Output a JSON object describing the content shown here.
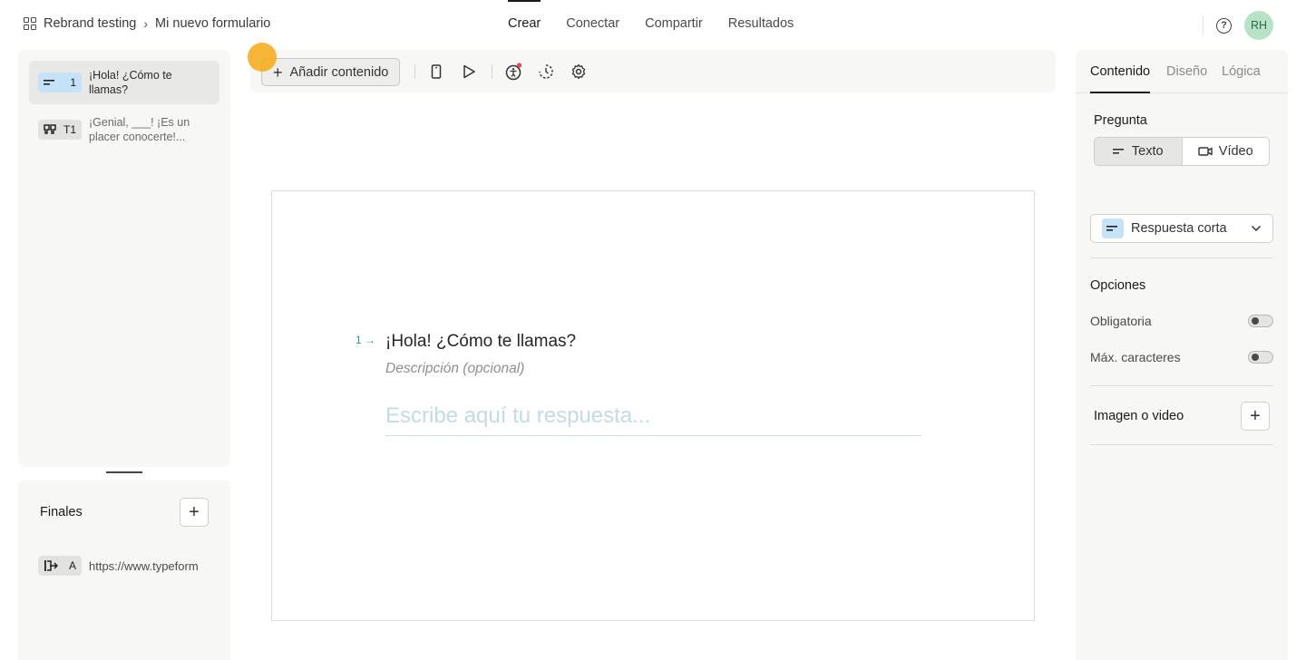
{
  "breadcrumb": {
    "workspace": "Rebrand testing",
    "separator": "›",
    "form": "Mi nuevo formulario"
  },
  "nav": {
    "tabs": [
      "Crear",
      "Conectar",
      "Compartir",
      "Resultados"
    ],
    "active": "Crear"
  },
  "user": {
    "initials": "RH"
  },
  "help": {
    "glyph": "?"
  },
  "questions": [
    {
      "badge_num": "1",
      "text": "¡Hola! ¿Cómo te llamas?",
      "icon": "short-text-icon",
      "active": true
    },
    {
      "badge_num": "T1",
      "text": "¡Genial, ___! ¡Es un placer conocerte!...",
      "icon": "quote-icon",
      "active": false
    }
  ],
  "endings": {
    "title": "Finales",
    "items": [
      {
        "badge": "A",
        "text": "https://www.typeform",
        "icon": "redirect-icon"
      }
    ]
  },
  "toolbar": {
    "add_label": "Añadir contenido",
    "icons": [
      "mobile-preview-icon",
      "play-icon",
      "accessibility-icon",
      "loading-icon",
      "settings-icon"
    ]
  },
  "canvas": {
    "question_number": "1",
    "question_title": "¡Hola! ¿Cómo te llamas?",
    "description": "Descripción (opcional)",
    "answer_placeholder": "Escribe aquí tu respuesta..."
  },
  "right_panel": {
    "tabs": [
      "Contenido",
      "Diseño",
      "Lógica"
    ],
    "active_tab": "Contenido",
    "pregunta_label": "Pregunta",
    "seg": {
      "text": "Texto",
      "video": "Vídeo",
      "active": "Texto"
    },
    "type_dropdown": "Respuesta corta",
    "opciones_label": "Opciones",
    "options": [
      {
        "label": "Obligatoria",
        "enabled": false
      },
      {
        "label": "Máx. caracteres",
        "enabled": false
      }
    ],
    "image_label": "Imagen o video"
  },
  "colors": {
    "accent_blue": "#c6e2f8",
    "cursor": "#f7a914",
    "avatar": "#b9e3c6",
    "teal": "#3b8ea5",
    "notification": "#e5484d"
  }
}
